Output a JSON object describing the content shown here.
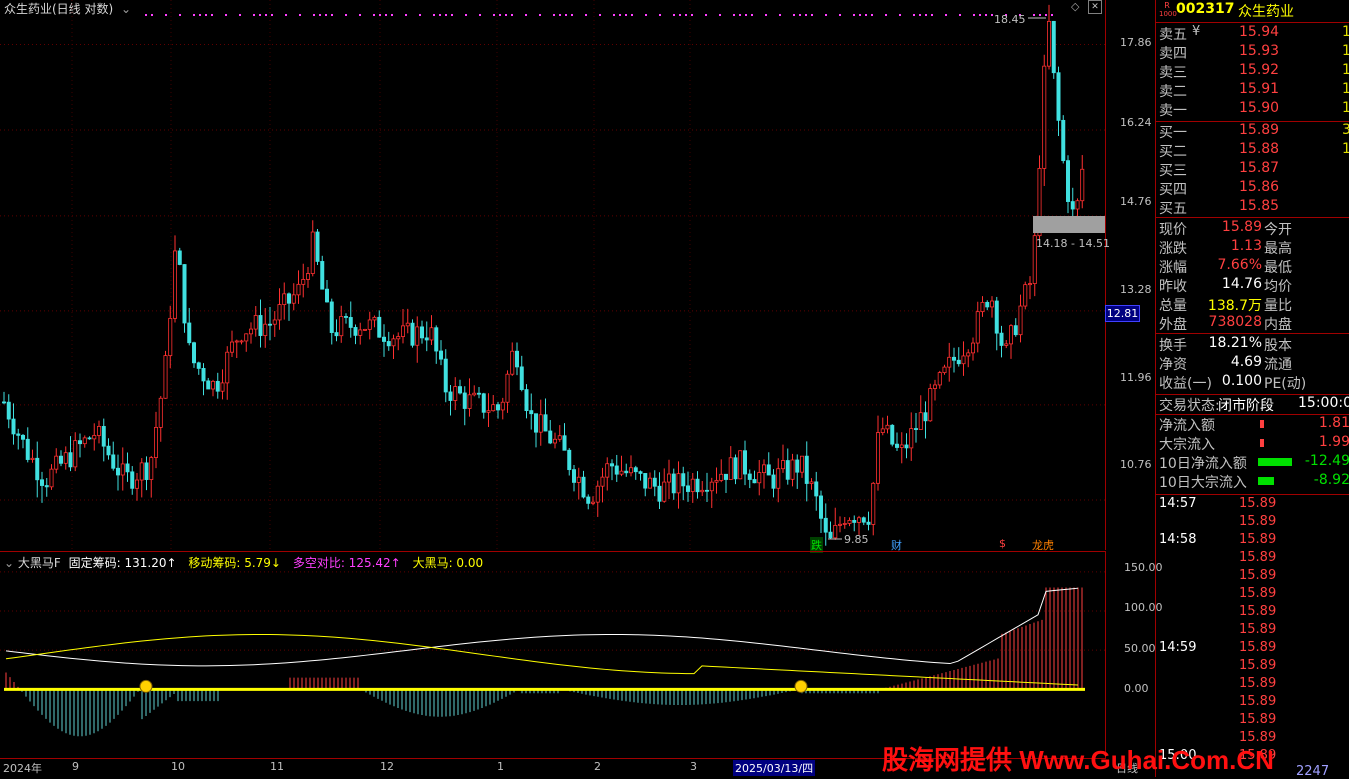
{
  "header": {
    "title": "众生药业(日线 对数)",
    "indicator_name": "大黑马F",
    "ind_items": [
      {
        "label": "固定筹码: 131.20↑",
        "color": "#ffffff"
      },
      {
        "label": "移动筹码: 5.79↓",
        "color": "#ffff00"
      },
      {
        "label": "多空对比: 125.42↑",
        "color": "#ff40ff"
      },
      {
        "label": "大黑马: 0.00",
        "color": "#ffff00"
      }
    ]
  },
  "y_axis_labels": [
    "17.86",
    "16.24",
    "14.76",
    "13.28",
    "11.96",
    "10.76"
  ],
  "current_price_tag": "12.81",
  "ind_axis_labels": [
    "150.00",
    "100.00",
    "50.00",
    "0.00"
  ],
  "x_axis_labels": [
    "2024年",
    "9",
    "10",
    "11",
    "12",
    "1",
    "2",
    "3",
    "2025/03/13/四",
    "日线"
  ],
  "annotations": {
    "high": "18.45",
    "low": "9.85",
    "range_box": "14.18 - 14.51",
    "event_tags": [
      "跌",
      "财",
      "$",
      "龙虎"
    ]
  },
  "chart_data": {
    "type": "candlestick",
    "title": "众生药业(日线 对数)",
    "ylim": [
      10.2,
      18.6
    ],
    "y_ticks": [
      17.86,
      16.24,
      14.76,
      13.28,
      11.96,
      10.76
    ],
    "high": 18.45,
    "low": 9.85,
    "last_close": 15.89,
    "indicator": {
      "name": "大黑马F",
      "fixed_chips": 131.2,
      "moving_chips": 5.79,
      "long_short_ratio": 125.42,
      "dark_horse": 0.0,
      "ylim": [
        -80,
        160
      ]
    }
  },
  "quote": {
    "code": "002317",
    "name": "众生药业",
    "badge_top": "R",
    "badge_bottom": "1000",
    "sell": [
      {
        "label": "卖五",
        "price": "15.94",
        "qty": "1"
      },
      {
        "label": "卖四",
        "price": "15.93",
        "qty": "1"
      },
      {
        "label": "卖三",
        "price": "15.92",
        "qty": "1"
      },
      {
        "label": "卖二",
        "price": "15.91",
        "qty": "1"
      },
      {
        "label": "卖一",
        "price": "15.90",
        "qty": "1"
      }
    ],
    "sell_extra": "¥",
    "buy": [
      {
        "label": "买一",
        "price": "15.89",
        "qty": "3"
      },
      {
        "label": "买二",
        "price": "15.88",
        "qty": "1"
      },
      {
        "label": "买三",
        "price": "15.87",
        "qty": ""
      },
      {
        "label": "买四",
        "price": "15.86",
        "qty": ""
      },
      {
        "label": "买五",
        "price": "15.85",
        "qty": ""
      }
    ],
    "stats": [
      {
        "l": "现价",
        "v": "15.89",
        "r": "今开",
        "vc": "red"
      },
      {
        "l": "涨跌",
        "v": "1.13",
        "r": "最高",
        "vc": "red"
      },
      {
        "l": "涨幅",
        "v": "7.66%",
        "r": "最低",
        "vc": "red"
      },
      {
        "l": "昨收",
        "v": "14.76",
        "r": "均价",
        "vc": "white"
      },
      {
        "l": "总量",
        "v": "138.7万",
        "r": "量比",
        "vc": "yellow"
      },
      {
        "l": "外盘",
        "v": "738028",
        "r": "内盘",
        "vc": "red"
      }
    ],
    "stats2": [
      {
        "l": "换手",
        "v": "18.21%",
        "r": "股本",
        "vc": "white"
      },
      {
        "l": "净资",
        "v": "4.69",
        "r": "流通",
        "vc": "white"
      },
      {
        "l": "收益(一)",
        "v": "0.100",
        "r": "PE(动)",
        "vc": "white"
      }
    ],
    "trade_state_label": "交易状态:",
    "trade_state": "闭市阶段",
    "trade_time": "15:00:00",
    "flows": [
      {
        "l": "净流入额",
        "v": "1.81",
        "c": "red",
        "bar": 4
      },
      {
        "l": "大宗流入",
        "v": "1.99",
        "c": "red",
        "bar": 4
      },
      {
        "l": "10日净流入额",
        "v": "-12.49",
        "c": "green",
        "bar": 60
      },
      {
        "l": "10日大宗流入",
        "v": "-8.92",
        "c": "green",
        "bar": 24
      }
    ],
    "ticks": [
      {
        "t": "14:57",
        "p": "15.89"
      },
      {
        "t": "",
        "p": "15.89"
      },
      {
        "t": "14:58",
        "p": "15.89"
      },
      {
        "t": "",
        "p": "15.89"
      },
      {
        "t": "",
        "p": "15.89"
      },
      {
        "t": "",
        "p": "15.89"
      },
      {
        "t": "",
        "p": "15.89"
      },
      {
        "t": "",
        "p": "15.89"
      },
      {
        "t": "14:59",
        "p": "15.89"
      },
      {
        "t": "",
        "p": "15.89"
      },
      {
        "t": "",
        "p": "15.89"
      },
      {
        "t": "",
        "p": "15.89"
      },
      {
        "t": "",
        "p": "15.89"
      },
      {
        "t": "",
        "p": "15.89"
      },
      {
        "t": "15:00",
        "p": "15.89"
      }
    ],
    "last_vol": "2247"
  },
  "watermark": "股海网提供 Www.Guhai.Com.CN"
}
